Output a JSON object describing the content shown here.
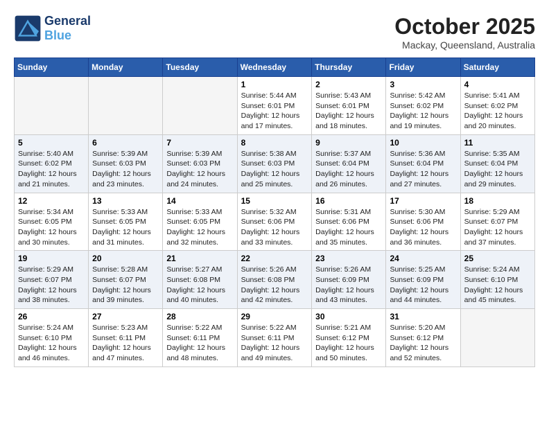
{
  "header": {
    "logo_line1": "General",
    "logo_line2": "Blue",
    "month": "October 2025",
    "location": "Mackay, Queensland, Australia"
  },
  "days_of_week": [
    "Sunday",
    "Monday",
    "Tuesday",
    "Wednesday",
    "Thursday",
    "Friday",
    "Saturday"
  ],
  "weeks": [
    [
      {
        "day": "",
        "info": ""
      },
      {
        "day": "",
        "info": ""
      },
      {
        "day": "",
        "info": ""
      },
      {
        "day": "1",
        "info": "Sunrise: 5:44 AM\nSunset: 6:01 PM\nDaylight: 12 hours\nand 17 minutes."
      },
      {
        "day": "2",
        "info": "Sunrise: 5:43 AM\nSunset: 6:01 PM\nDaylight: 12 hours\nand 18 minutes."
      },
      {
        "day": "3",
        "info": "Sunrise: 5:42 AM\nSunset: 6:02 PM\nDaylight: 12 hours\nand 19 minutes."
      },
      {
        "day": "4",
        "info": "Sunrise: 5:41 AM\nSunset: 6:02 PM\nDaylight: 12 hours\nand 20 minutes."
      }
    ],
    [
      {
        "day": "5",
        "info": "Sunrise: 5:40 AM\nSunset: 6:02 PM\nDaylight: 12 hours\nand 21 minutes."
      },
      {
        "day": "6",
        "info": "Sunrise: 5:39 AM\nSunset: 6:03 PM\nDaylight: 12 hours\nand 23 minutes."
      },
      {
        "day": "7",
        "info": "Sunrise: 5:39 AM\nSunset: 6:03 PM\nDaylight: 12 hours\nand 24 minutes."
      },
      {
        "day": "8",
        "info": "Sunrise: 5:38 AM\nSunset: 6:03 PM\nDaylight: 12 hours\nand 25 minutes."
      },
      {
        "day": "9",
        "info": "Sunrise: 5:37 AM\nSunset: 6:04 PM\nDaylight: 12 hours\nand 26 minutes."
      },
      {
        "day": "10",
        "info": "Sunrise: 5:36 AM\nSunset: 6:04 PM\nDaylight: 12 hours\nand 27 minutes."
      },
      {
        "day": "11",
        "info": "Sunrise: 5:35 AM\nSunset: 6:04 PM\nDaylight: 12 hours\nand 29 minutes."
      }
    ],
    [
      {
        "day": "12",
        "info": "Sunrise: 5:34 AM\nSunset: 6:05 PM\nDaylight: 12 hours\nand 30 minutes."
      },
      {
        "day": "13",
        "info": "Sunrise: 5:33 AM\nSunset: 6:05 PM\nDaylight: 12 hours\nand 31 minutes."
      },
      {
        "day": "14",
        "info": "Sunrise: 5:33 AM\nSunset: 6:05 PM\nDaylight: 12 hours\nand 32 minutes."
      },
      {
        "day": "15",
        "info": "Sunrise: 5:32 AM\nSunset: 6:06 PM\nDaylight: 12 hours\nand 33 minutes."
      },
      {
        "day": "16",
        "info": "Sunrise: 5:31 AM\nSunset: 6:06 PM\nDaylight: 12 hours\nand 35 minutes."
      },
      {
        "day": "17",
        "info": "Sunrise: 5:30 AM\nSunset: 6:06 PM\nDaylight: 12 hours\nand 36 minutes."
      },
      {
        "day": "18",
        "info": "Sunrise: 5:29 AM\nSunset: 6:07 PM\nDaylight: 12 hours\nand 37 minutes."
      }
    ],
    [
      {
        "day": "19",
        "info": "Sunrise: 5:29 AM\nSunset: 6:07 PM\nDaylight: 12 hours\nand 38 minutes."
      },
      {
        "day": "20",
        "info": "Sunrise: 5:28 AM\nSunset: 6:07 PM\nDaylight: 12 hours\nand 39 minutes."
      },
      {
        "day": "21",
        "info": "Sunrise: 5:27 AM\nSunset: 6:08 PM\nDaylight: 12 hours\nand 40 minutes."
      },
      {
        "day": "22",
        "info": "Sunrise: 5:26 AM\nSunset: 6:08 PM\nDaylight: 12 hours\nand 42 minutes."
      },
      {
        "day": "23",
        "info": "Sunrise: 5:26 AM\nSunset: 6:09 PM\nDaylight: 12 hours\nand 43 minutes."
      },
      {
        "day": "24",
        "info": "Sunrise: 5:25 AM\nSunset: 6:09 PM\nDaylight: 12 hours\nand 44 minutes."
      },
      {
        "day": "25",
        "info": "Sunrise: 5:24 AM\nSunset: 6:10 PM\nDaylight: 12 hours\nand 45 minutes."
      }
    ],
    [
      {
        "day": "26",
        "info": "Sunrise: 5:24 AM\nSunset: 6:10 PM\nDaylight: 12 hours\nand 46 minutes."
      },
      {
        "day": "27",
        "info": "Sunrise: 5:23 AM\nSunset: 6:11 PM\nDaylight: 12 hours\nand 47 minutes."
      },
      {
        "day": "28",
        "info": "Sunrise: 5:22 AM\nSunset: 6:11 PM\nDaylight: 12 hours\nand 48 minutes."
      },
      {
        "day": "29",
        "info": "Sunrise: 5:22 AM\nSunset: 6:11 PM\nDaylight: 12 hours\nand 49 minutes."
      },
      {
        "day": "30",
        "info": "Sunrise: 5:21 AM\nSunset: 6:12 PM\nDaylight: 12 hours\nand 50 minutes."
      },
      {
        "day": "31",
        "info": "Sunrise: 5:20 AM\nSunset: 6:12 PM\nDaylight: 12 hours\nand 52 minutes."
      },
      {
        "day": "",
        "info": ""
      }
    ]
  ]
}
